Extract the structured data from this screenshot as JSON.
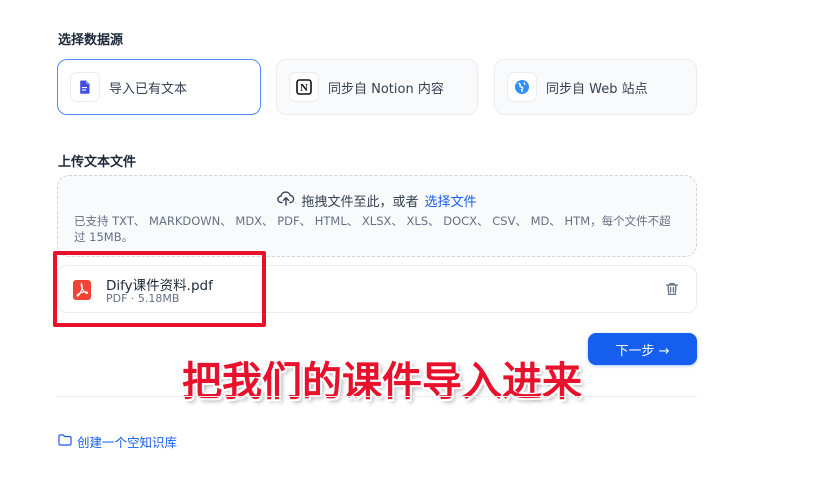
{
  "section_source": {
    "title": "选择数据源"
  },
  "sources": [
    {
      "label": "导入已有文本",
      "icon": "document-icon",
      "selected": true
    },
    {
      "label": "同步自 Notion 内容",
      "icon": "notion-icon",
      "selected": false
    },
    {
      "label": "同步自 Web 站点",
      "icon": "web-icon",
      "selected": false
    }
  ],
  "section_upload": {
    "title": "上传文本文件"
  },
  "dropzone": {
    "text": "拖拽文件至此，或者",
    "link": "选择文件",
    "hint": "已支持 TXT、 MARKDOWN、 MDX、 PDF、 HTML、 XLSX、 XLS、 DOCX、 CSV、 MD、 HTM，每个文件不超过 15MB。"
  },
  "file": {
    "name": "Dify课件资料.pdf",
    "meta": "PDF · 5.18MB"
  },
  "next_button": {
    "label": "下一步 →"
  },
  "annotation": {
    "text": "把我们的课件导入进来"
  },
  "empty_kb_link": {
    "label": "创建一个空知识库"
  },
  "colors": {
    "accent": "#155eef",
    "highlight": "#e8102a",
    "pdf": "#f04438"
  }
}
